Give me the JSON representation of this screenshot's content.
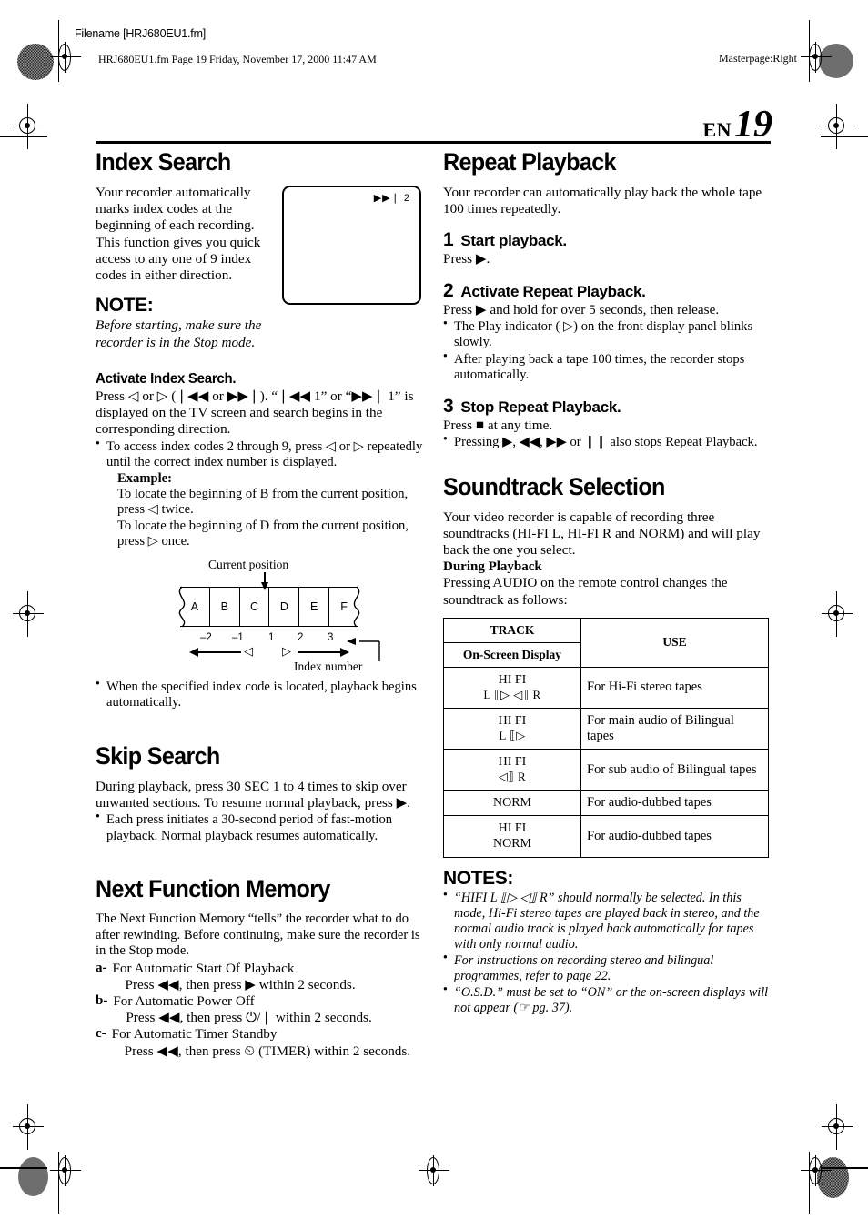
{
  "printmarks": {
    "filename_box": "Filename [HRJ680EU1.fm]",
    "file_line": "HRJ680EU1.fm  Page 19  Friday, November 17, 2000  11:47 AM",
    "masterpage": "Masterpage:Right"
  },
  "page": {
    "lang_code": "EN",
    "number": "19"
  },
  "left_column": {
    "index_search": {
      "title": "Index Search",
      "intro": "Your recorder automatically marks index codes at the beginning of each recording. This function gives you quick access to any one of 9 index codes in either direction.",
      "note_heading": "NOTE:",
      "note_text": "Before starting, make sure the recorder is in the Stop mode.",
      "tv_osd": "▶▶❘ 2",
      "activate_heading": "Activate Index Search.",
      "activate_body": "Press ◁ or ▷ (❘◀◀ or ▶▶❘). “❘◀◀ 1” or “▶▶❘ 1” is displayed on the TV screen and search begins in the corresponding direction.",
      "bullets": [
        "To access index codes 2 through 9, press ◁ or ▷ repeatedly until the correct index number is displayed."
      ],
      "example_label": "Example:",
      "example_lines": [
        "To locate the beginning of B from the current position, press ◁ twice.",
        "To locate the beginning of D from the current position, press ▷ once."
      ],
      "diagram": {
        "current_position_label": "Current position",
        "index_number_label": "Index number",
        "segments": [
          "A",
          "B",
          "C",
          "D",
          "E",
          "F"
        ],
        "ticks": [
          "–2",
          "–1",
          "1",
          "2",
          "3"
        ],
        "left_arrow_symbol": "◁",
        "right_arrow_symbol": "▷"
      },
      "closing_bullet": "When the specified index code is located, playback begins automatically."
    },
    "skip_search": {
      "title": "Skip Search",
      "body": "During playback, press 30 SEC 1 to 4 times to skip over unwanted sections. To resume normal playback, press ▶.",
      "body_bold_1": "30 SEC",
      "bullets": [
        "Each press initiates a 30-second period of fast-motion playback. Normal playback resumes automatically."
      ]
    },
    "next_function_memory": {
      "title": "Next Function Memory",
      "intro": "The Next Function Memory “tells” the recorder what to do after rewinding. Before continuing, make sure the recorder is in the Stop mode.",
      "items": [
        {
          "label": "a-",
          "heading": "For Automatic Start Of Playback",
          "action": "Press ◀◀, then press ▶ within 2 seconds."
        },
        {
          "label": "b-",
          "heading": "For Automatic Power Off",
          "action": "Press ◀◀, then press ⏻/❘ within 2 seconds."
        },
        {
          "label": "c-",
          "heading": "For Automatic Timer Standby",
          "action": "Press ◀◀, then press ⏲ (TIMER) within 2 seconds.",
          "action_bold": "TIMER"
        }
      ]
    }
  },
  "right_column": {
    "repeat_playback": {
      "title": "Repeat Playback",
      "intro": "Your recorder can automatically play back the whole tape 100 times repeatedly.",
      "steps": [
        {
          "number": "1",
          "heading": "Start playback.",
          "body": "Press ▶.",
          "bullets": []
        },
        {
          "number": "2",
          "heading": "Activate Repeat Playback.",
          "body": "Press ▶ and hold for over 5 seconds, then release.",
          "bullets": [
            "The Play indicator ( ▷) on the front display panel blinks slowly.",
            "After playing back a tape 100 times, the recorder stops automatically."
          ]
        },
        {
          "number": "3",
          "heading": "Stop Repeat Playback.",
          "body": "Press ■ at any time.",
          "bullets": [
            "Pressing ▶, ◀◀, ▶▶ or ❙❙ also stops Repeat Playback."
          ]
        }
      ]
    },
    "soundtrack_selection": {
      "title": "Soundtrack Selection",
      "intro": "Your video recorder is capable of recording three soundtracks (HI-FI L, HI-FI R and NORM) and will play back the one you select.",
      "during_playback_heading": "During Playback",
      "during_playback_body": "Pressing AUDIO on the remote control changes the soundtrack as follows:",
      "during_playback_bold": "AUDIO",
      "table": {
        "header_track": "TRACK",
        "header_osd": "On-Screen Display",
        "header_use": "USE",
        "rows": [
          {
            "track_line1": "HI FI",
            "track_line2": "L ⟦▷ ◁⟧ R",
            "use": "For Hi-Fi stereo tapes"
          },
          {
            "track_line1": "HI FI",
            "track_line2": "L ⟦▷",
            "use": "For main audio of Bilingual tapes"
          },
          {
            "track_line1": "HI FI",
            "track_line2": "◁⟧ R",
            "use": "For sub audio of Bilingual tapes"
          },
          {
            "track_line1": "NORM",
            "track_line2": "",
            "use": "For audio-dubbed tapes"
          },
          {
            "track_line1": "HI FI",
            "track_line2": "NORM",
            "use": "For audio-dubbed tapes"
          }
        ]
      },
      "notes_heading": "NOTES:",
      "notes": [
        "“HIFI L ⟦▷ ◁⟧ R” should normally be selected. In this mode, Hi-Fi stereo tapes are played back in stereo, and the normal audio track is played back automatically for tapes with only normal audio.",
        "For instructions on recording stereo and bilingual programmes, refer to page 22.",
        "“O.S.D.” must be set to “ON” or the on-screen displays will not appear (☞ pg. 37)."
      ]
    }
  }
}
